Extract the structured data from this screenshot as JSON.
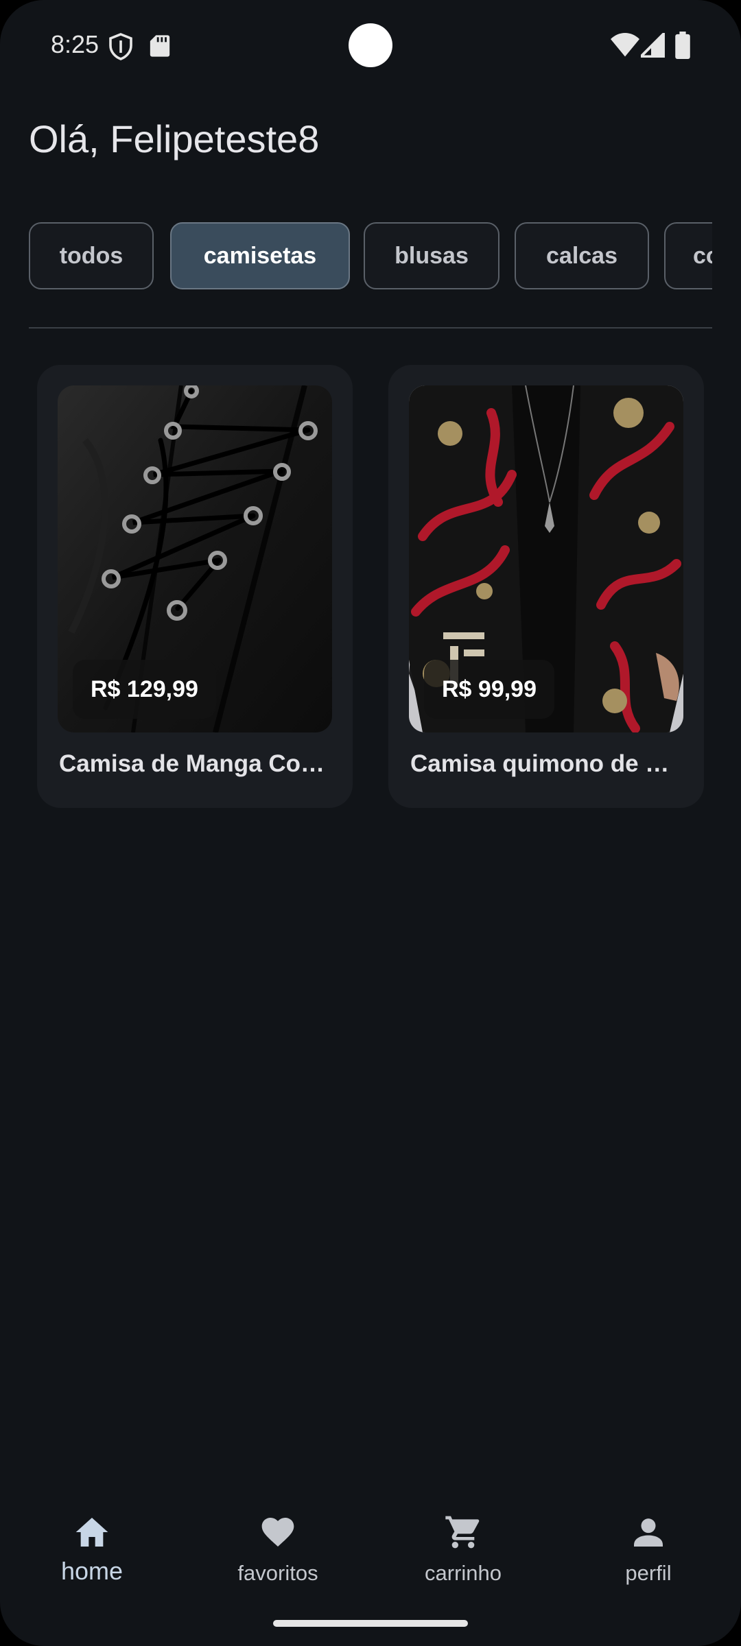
{
  "status_bar": {
    "time": "8:25",
    "icons": [
      "shield-icon",
      "sd-card-icon",
      "wifi-icon",
      "signal-icon",
      "battery-icon"
    ]
  },
  "greeting": "Olá, Felipeteste8",
  "categories": {
    "items": [
      {
        "label": "todos",
        "selected": false
      },
      {
        "label": "camisetas",
        "selected": true
      },
      {
        "label": "blusas",
        "selected": false
      },
      {
        "label": "calcas",
        "selected": false
      },
      {
        "label": "co",
        "selected": false
      }
    ]
  },
  "products": [
    {
      "price": "R$ 129,99",
      "title": "Camisa de Manga Co…",
      "image": "black-laced-shirt"
    },
    {
      "price": "R$ 99,99",
      "title": "Camisa quimono de …",
      "image": "dragon-kimono-shirt"
    }
  ],
  "bottom_nav": {
    "items": [
      {
        "label": "home",
        "icon": "home-icon",
        "active": true
      },
      {
        "label": "favoritos",
        "icon": "heart-icon",
        "active": false
      },
      {
        "label": "carrinho",
        "icon": "cart-icon",
        "active": false
      },
      {
        "label": "perfil",
        "icon": "person-icon",
        "active": false
      }
    ]
  },
  "colors": {
    "background": "#111418",
    "card": "#1a1d22",
    "chip_selected": "#3a4c5c",
    "nav_active": "#c8d6e6",
    "kimono_red": "#b0182a"
  }
}
